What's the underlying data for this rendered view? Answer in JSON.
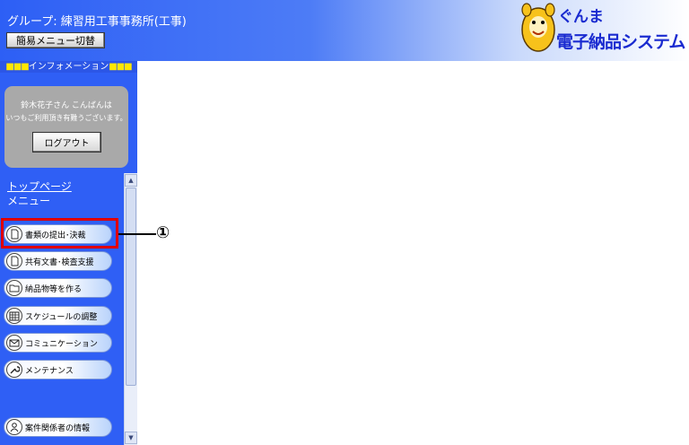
{
  "header": {
    "group_title": "グループ: 練習用工事事務所(工事)",
    "menu_switch_label": "簡易メニュー切替",
    "logo": {
      "line1": "ぐんま",
      "line2": "電子納品システム",
      "mascot_icon": "mascot-icon"
    }
  },
  "info": {
    "bar_squares": "■■■",
    "bar_label": "インフォメーション",
    "greeting_line1": "鈴木花子さん こんばんは",
    "greeting_line2": "いつもご利用頂き有難うございます。",
    "logout_label": "ログアウト"
  },
  "nav": {
    "toppage_label": "トップページ",
    "menu_label": "メニュー",
    "items": [
      {
        "label": "書類の提出･決裁",
        "icon": "document-icon"
      },
      {
        "label": "共有文書･検査支援",
        "icon": "document-icon"
      },
      {
        "label": "納品物等を作る",
        "icon": "folder-icon"
      },
      {
        "label": "スケジュールの調整",
        "icon": "calendar-icon"
      },
      {
        "label": "コミュニケーション",
        "icon": "mail-icon"
      },
      {
        "label": "メンテナンス",
        "icon": "wrench-icon"
      },
      {
        "label": "案件関係者の情報",
        "icon": "person-icon"
      }
    ]
  },
  "scrollbar": {
    "up": "▲",
    "down": "▼"
  },
  "annotation": {
    "number": "①"
  },
  "colors": {
    "header_blue": "#2d5ff5",
    "sidebar_blue": "#2f5ff5",
    "highlight_red": "#e00000",
    "logo_blue": "#1a2bd0",
    "info_squares": "#ffe800"
  }
}
